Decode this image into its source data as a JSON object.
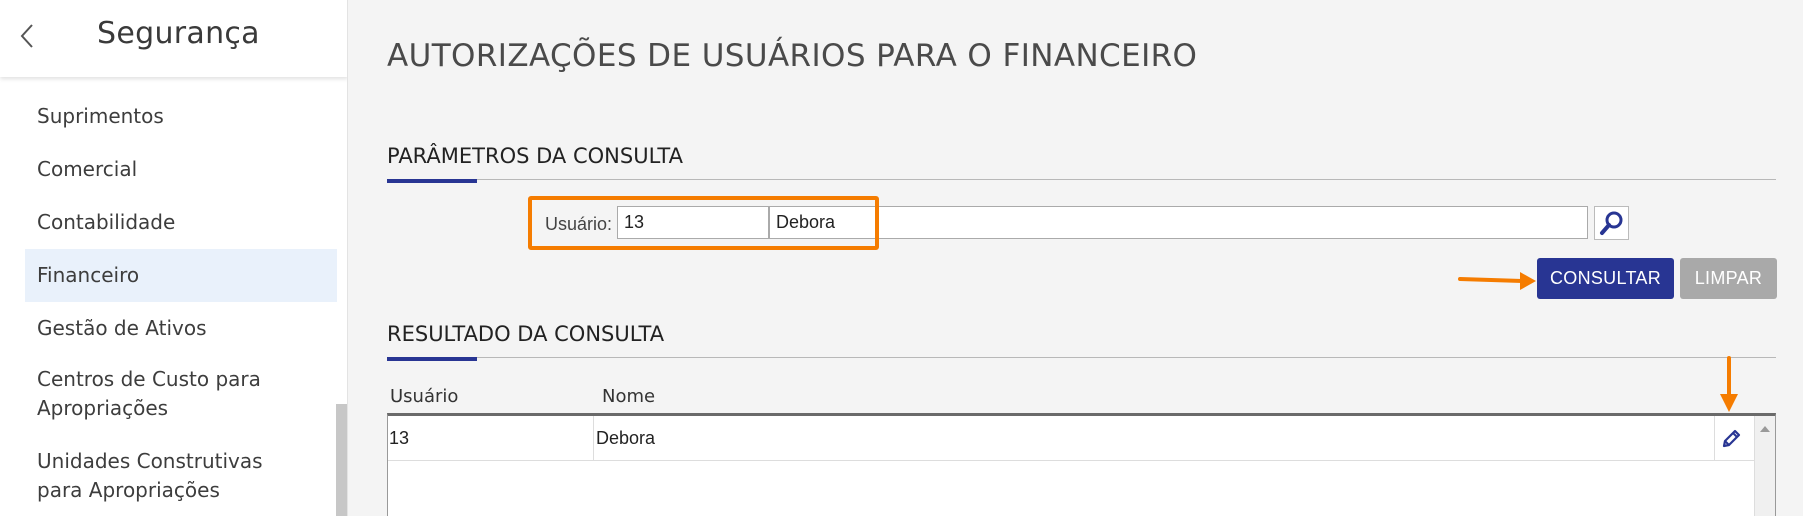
{
  "sidebar": {
    "title": "Segurança",
    "items": [
      {
        "label": "Suprimentos"
      },
      {
        "label": "Comercial"
      },
      {
        "label": "Contabilidade"
      },
      {
        "label": "Financeiro"
      },
      {
        "label": "Gestão de Ativos"
      },
      {
        "label_line1": "Centros de Custo para",
        "label_line2": "Apropriações"
      },
      {
        "label_line1": "Unidades Construtivas",
        "label_line2": "para Apropriações"
      }
    ]
  },
  "page": {
    "title": "AUTORIZAÇÕES DE USUÁRIOS PARA O FINANCEIRO"
  },
  "params": {
    "section_title": "PARÂMETROS DA CONSULTA",
    "user_label": "Usuário:",
    "user_code": "13",
    "user_name": "Debora",
    "consultar_label": "CONSULTAR",
    "limpar_label": "LIMPAR"
  },
  "results": {
    "section_title": "RESULTADO DA CONSULTA",
    "columns": [
      "Usuário",
      "Nome"
    ],
    "rows": [
      {
        "usuario": "13",
        "nome": "Debora"
      }
    ]
  },
  "colors": {
    "primary": "#283593",
    "annotation": "#f57c00",
    "active_item_bg": "#e9f1fb"
  },
  "icons": [
    "chevron-left-icon",
    "magnifier-icon",
    "pencil-icon"
  ]
}
